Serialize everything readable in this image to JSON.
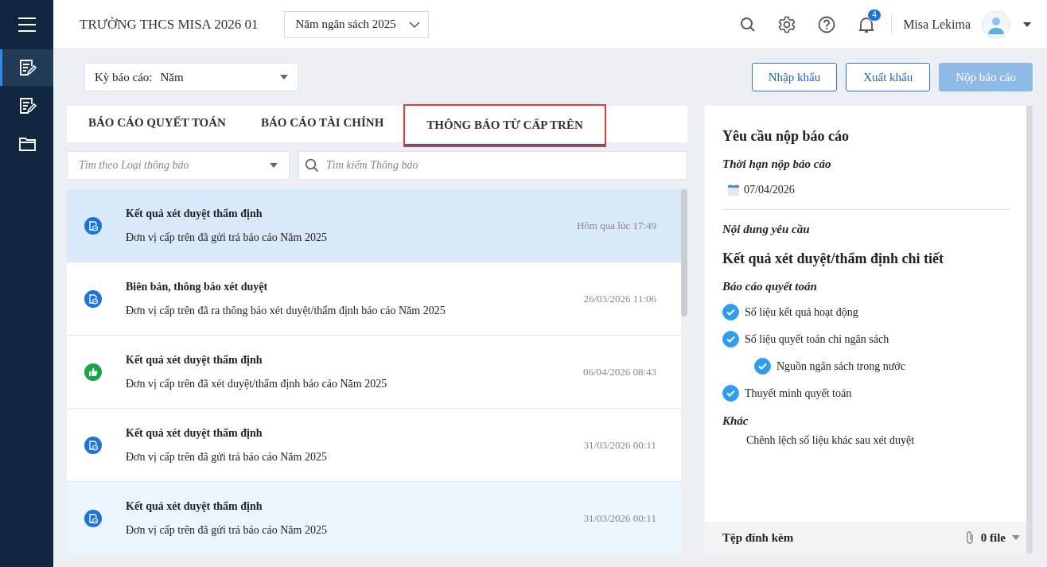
{
  "header": {
    "org": "TRƯỜNG THCS MISA 2026 01",
    "budget_year": "Năm ngân sách 2025",
    "notification_count": "4",
    "user": "Misa Lekima"
  },
  "sidebar": {
    "items": [
      {
        "kind": "report",
        "selected": true
      },
      {
        "kind": "report",
        "selected": false
      },
      {
        "kind": "folder",
        "selected": false
      }
    ]
  },
  "period": {
    "label": "Kỳ báo cáo:",
    "value": "Năm"
  },
  "actions": [
    {
      "label": "Nhập khẩu",
      "disabled": false
    },
    {
      "label": "Xuất khẩu",
      "disabled": false
    },
    {
      "label": "Nộp báo cáo",
      "disabled": true
    }
  ],
  "tabs": [
    {
      "label": "BÁO CÁO QUYẾT TOÁN",
      "selected": false,
      "highlighted": false
    },
    {
      "label": "BÁO CÁO TÀI CHÍNH",
      "selected": false,
      "highlighted": false
    },
    {
      "label": "THÔNG BÁO TỪ CẤP TRÊN",
      "selected": true,
      "highlighted": true
    }
  ],
  "filters": {
    "type_placeholder": "Tìm theo Loại thông báo",
    "search_placeholder": "Tìm kiếm Thông báo"
  },
  "notifications": [
    {
      "kind": "document",
      "title": "Kết quả xét duyệt thẩm định",
      "message": "Đơn vị cấp trên đã gửi trả báo cáo Năm 2025",
      "time": "Hôm qua lúc 17:49",
      "selected": true,
      "hovered": false
    },
    {
      "kind": "document",
      "title": "Biên bản, thông báo xét duyệt",
      "message": "Đơn vị cấp trên đã ra thông báo xét duyệt/thẩm định báo cáo Năm 2025",
      "time": "26/03/2026 11:06",
      "selected": false,
      "hovered": false
    },
    {
      "kind": "approved",
      "title": "Kết quả xét duyệt thẩm định",
      "message": "Đơn vị cấp trên đã xét duyệt/thẩm định báo cáo Năm 2025",
      "time": "06/04/2026 08:43",
      "selected": false,
      "hovered": false
    },
    {
      "kind": "document",
      "title": "Kết quả xét duyệt thẩm định",
      "message": "Đơn vị cấp trên đã gửi trả báo cáo Năm 2025",
      "time": "31/03/2026 00:11",
      "selected": false,
      "hovered": false
    },
    {
      "kind": "document",
      "title": "Kết quả xét duyệt thẩm định",
      "message": "Đơn vị cấp trên đã gửi trả báo cáo Năm 2025",
      "time": "31/03/2026 00:11",
      "selected": false,
      "hovered": true
    }
  ],
  "detail": {
    "title": "Yêu cầu nộp báo cáo",
    "deadline_label": "Thời hạn nộp báo cáo",
    "deadline": "07/04/2026",
    "content_label": "Nội dung yêu cầu",
    "heading": "Kết quả xét duyệt/thẩm định chi tiết",
    "section": "Báo cáo quyết toán",
    "checklist": [
      {
        "label": "Số liệu kết quả hoạt động",
        "checked": true
      },
      {
        "label": "Số liệu quyết toán chi ngân sách",
        "checked": true,
        "children": [
          {
            "label": "Nguồn ngân sách trong nước",
            "checked": true
          }
        ]
      },
      {
        "label": "Thuyết minh quyết toán",
        "checked": true
      }
    ],
    "other_label": "Khác",
    "other_items": [
      "Chênh lệch số liệu khác sau xét duyệt"
    ],
    "attachments_label": "Tệp đính kèm",
    "attachments_count": "0 file"
  }
}
